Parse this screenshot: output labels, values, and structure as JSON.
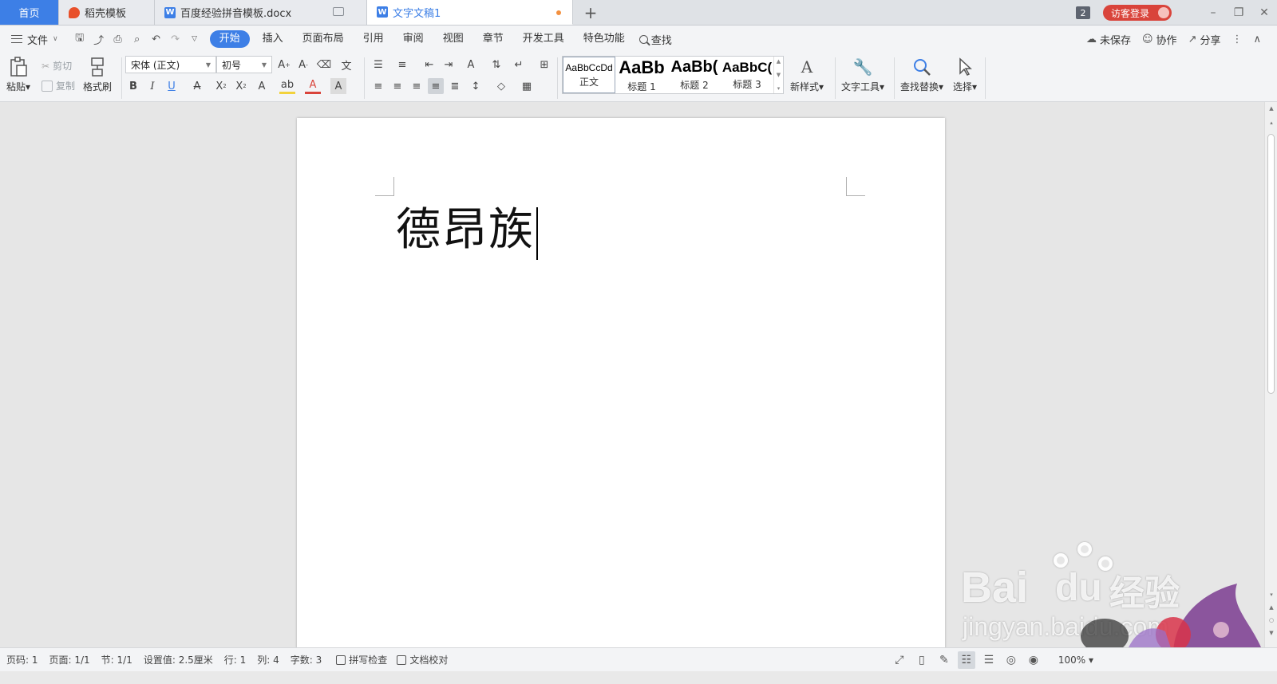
{
  "tabs": {
    "home": "首页",
    "daoke": "稻壳模板",
    "doc1": "百度经验拼音模板.docx",
    "doc2": "文字文稿1",
    "new_tab": "+"
  },
  "titlebar": {
    "window_count": "2",
    "login": "访客登录"
  },
  "menu": {
    "file": "文件",
    "tabs": [
      "开始",
      "插入",
      "页面布局",
      "引用",
      "审阅",
      "视图",
      "章节",
      "开发工具",
      "特色功能"
    ],
    "search": "查找",
    "unsaved": "未保存",
    "collab": "协作",
    "share": "分享"
  },
  "ribbon": {
    "paste": "粘贴",
    "cut": "剪切",
    "copy": "复制",
    "format_painter": "格式刷",
    "font_name": "宋体 (正文)",
    "font_size": "初号",
    "styles": [
      {
        "sample": "AaBbCcDd",
        "name": "正文"
      },
      {
        "sample": "AaBb",
        "name": "标题 1"
      },
      {
        "sample": "AaBb(",
        "name": "标题 2"
      },
      {
        "sample": "AaBbC(",
        "name": "标题 3"
      }
    ],
    "new_style": "新样式",
    "text_tools": "文字工具",
    "find_replace": "查找替换",
    "select": "选择"
  },
  "document": {
    "text": "德昂族"
  },
  "status": {
    "page": "页码: 1",
    "pages": "页面: 1/1",
    "section": "节: 1/1",
    "setting": "设置值: 2.5厘米",
    "row": "行: 1",
    "col": "列: 4",
    "words": "字数: 3",
    "spellcheck": "拼写检查",
    "proofread": "文档校对",
    "zoom": "100%"
  },
  "watermark": {
    "brand": "Bai",
    "brand2": "du",
    "cn": "经验",
    "url": "jingyan.baidu.com"
  }
}
